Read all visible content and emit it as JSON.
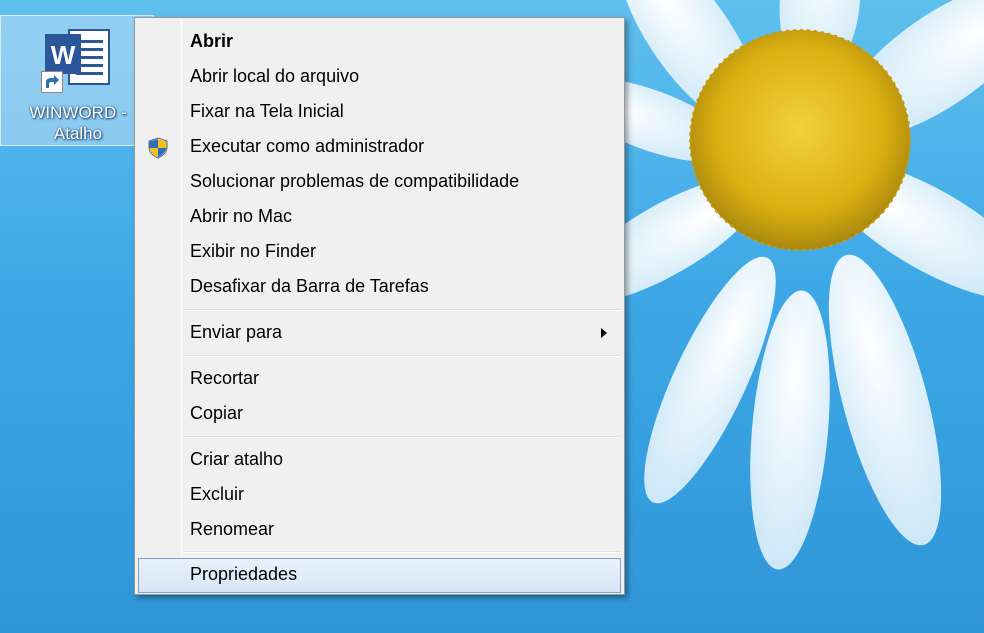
{
  "desktop_icon": {
    "label_line1": "WINWORD -",
    "label_line2": "Atalho",
    "icon": "word-document-icon",
    "shortcut_overlay": "shortcut-arrow-icon"
  },
  "context_menu": {
    "items": [
      {
        "label": "Abrir"
      },
      {
        "label": "Abrir local do arquivo"
      },
      {
        "label": "Fixar na Tela Inicial"
      },
      {
        "label": "Executar como administrador",
        "icon": "uac-shield-icon"
      },
      {
        "label": "Solucionar problemas de compatibilidade"
      },
      {
        "label": "Abrir no Mac"
      },
      {
        "label": "Exibir no Finder"
      },
      {
        "label": "Desafixar da Barra de Tarefas"
      },
      {
        "label": "Enviar para",
        "icon": "submenu-arrow-icon"
      },
      {
        "label": "Recortar"
      },
      {
        "label": "Copiar"
      },
      {
        "label": "Criar atalho"
      },
      {
        "label": "Excluir"
      },
      {
        "label": "Renomear"
      },
      {
        "label": "Propriedades"
      }
    ]
  },
  "colors": {
    "menu_background": "#f0f0f0",
    "menu_border": "#979797",
    "hover_background": "#d7e6f6",
    "hover_border": "#7da2ce",
    "wallpaper_sky": "#3ea8e6",
    "flower_center": "#e8c21a"
  }
}
